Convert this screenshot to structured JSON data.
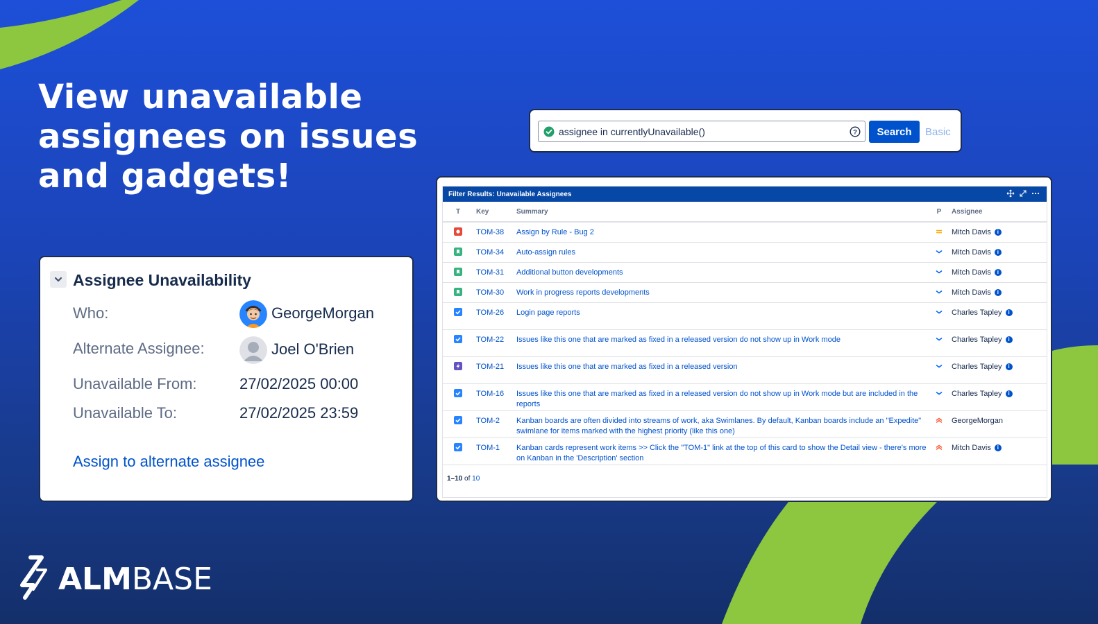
{
  "colors": {
    "background_top": "#1d4fd8",
    "background_bottom": "#142f6a",
    "accent_green": "#8dc63f",
    "jira_blue": "#0052cc",
    "gadget_header": "#0747a6"
  },
  "headline": "View unavailable assignees on issues and gadgets!",
  "search": {
    "query": "assignee in currentlyUnavailable()",
    "valid_icon": "check-circle-icon",
    "help_icon": "question-circle-icon",
    "button_label": "Search",
    "mode_link": "Basic"
  },
  "gadget": {
    "title": "Filter Results: Unavailable Assignees",
    "header_icons": [
      "move-icon",
      "expand-icon",
      "more-icon"
    ],
    "columns": {
      "type": "T",
      "key": "Key",
      "summary": "Summary",
      "priority": "P",
      "assignee": "Assignee"
    },
    "rows": [
      {
        "type": "bug",
        "key": "TOM-38",
        "summary": "Assign by Rule - Bug 2",
        "priority": "medium",
        "assignee": "Mitch Davis"
      },
      {
        "type": "story",
        "key": "TOM-34",
        "summary": "Auto-assign rules",
        "priority": "low",
        "assignee": "Mitch Davis"
      },
      {
        "type": "story",
        "key": "TOM-31",
        "summary": "Additional button developments",
        "priority": "low",
        "assignee": "Mitch Davis"
      },
      {
        "type": "story",
        "key": "TOM-30",
        "summary": "Work in progress reports developments",
        "priority": "low",
        "assignee": "Mitch Davis"
      },
      {
        "type": "task",
        "key": "TOM-26",
        "summary": "Login page reports",
        "priority": "low",
        "assignee": "Charles Tapley"
      },
      {
        "type": "task",
        "key": "TOM-22",
        "summary": "Issues like this one that are marked as fixed in a released version do not show up in Work mode",
        "priority": "low",
        "assignee": "Charles Tapley"
      },
      {
        "type": "epic",
        "key": "TOM-21",
        "summary": "Issues like this one that are marked as fixed in a released version",
        "priority": "low",
        "assignee": "Charles Tapley"
      },
      {
        "type": "task",
        "key": "TOM-16",
        "summary": "Issues like this one that are marked as fixed in a released version do not show up in Work mode but are included in the reports",
        "priority": "low",
        "assignee": "Charles Tapley"
      },
      {
        "type": "task",
        "key": "TOM-2",
        "summary": "Kanban boards are often divided into streams of work, aka Swimlanes. By default, Kanban boards include an \"Expedite\" swimlane for items marked with the highest priority (like this one)",
        "priority": "highest",
        "assignee": "GeorgeMorgan"
      },
      {
        "type": "task",
        "key": "TOM-1",
        "summary": "Kanban cards represent work items >> Click the \"TOM-1\" link at the top of this card to show the Detail view - there's more on Kanban in the 'Description' section",
        "priority": "highest",
        "assignee": "Mitch Davis"
      }
    ],
    "pager": {
      "range": "1–10",
      "of": "of",
      "total": "10"
    }
  },
  "unavailability": {
    "title": "Assignee Unavailability",
    "who_label": "Who:",
    "who_value": "GeorgeMorgan",
    "alternate_label": "Alternate Assignee:",
    "alternate_value": "Joel O'Brien",
    "from_label": "Unavailable From:",
    "from_value": "27/02/2025 00:00",
    "to_label": "Unavailable To:",
    "to_value": "27/02/2025 23:59",
    "assign_link": "Assign to alternate assignee"
  },
  "logo": {
    "text_bold": "ALM",
    "text_light": "BASE"
  }
}
